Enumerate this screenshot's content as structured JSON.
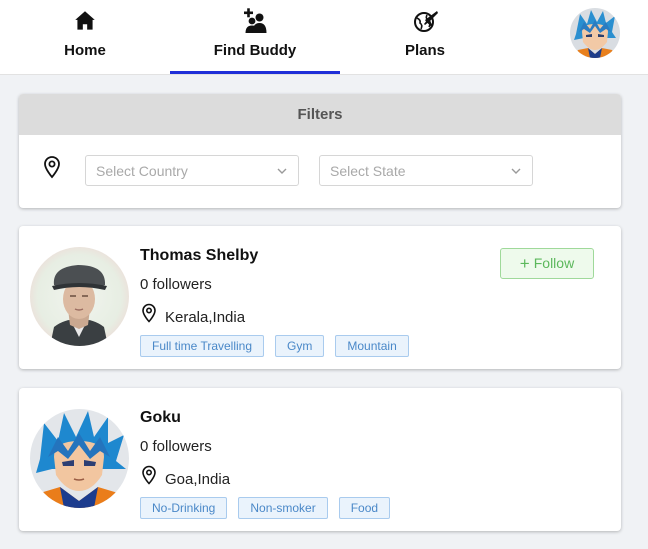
{
  "nav": {
    "items": [
      {
        "label": "Home",
        "icon": "home-icon"
      },
      {
        "label": "Find Buddy",
        "icon": "add-group-icon",
        "active": true
      },
      {
        "label": "Plans",
        "icon": "globe-plane-icon"
      }
    ],
    "accent_color": "#1f2fd8",
    "user_avatar": "user-avatar"
  },
  "filters": {
    "title": "Filters",
    "country_placeholder": "Select Country",
    "state_placeholder": "Select State"
  },
  "buddies": [
    {
      "name": "Thomas Shelby",
      "followers": "0 followers",
      "location": "Kerala,India",
      "tags": [
        "Full time Travelling",
        "Gym",
        "Mountain"
      ],
      "follow_label": "Follow"
    },
    {
      "name": "Goku",
      "followers": "0 followers",
      "location": "Goa,India",
      "tags": [
        "No-Drinking",
        "Non-smoker",
        "Food"
      ]
    }
  ]
}
